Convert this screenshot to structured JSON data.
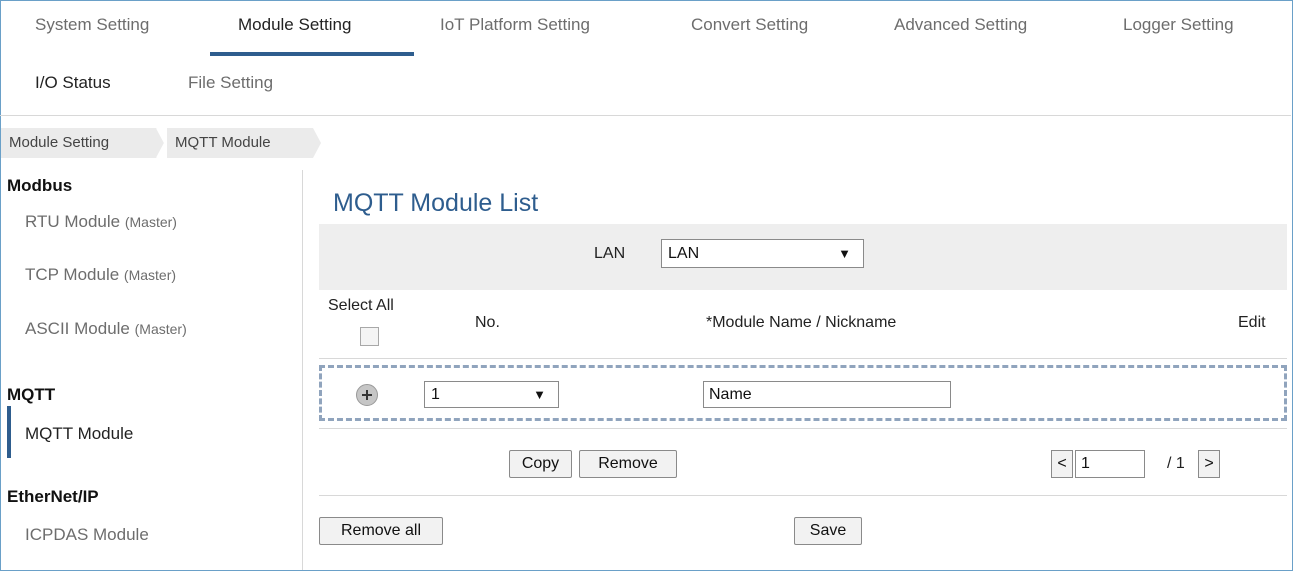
{
  "nav": {
    "tabs": [
      {
        "label": "System Setting"
      },
      {
        "label": "Module Setting"
      },
      {
        "label": "IoT Platform Setting"
      },
      {
        "label": "Convert Setting"
      },
      {
        "label": "Advanced Setting"
      },
      {
        "label": "Logger Setting"
      },
      {
        "label": "I/O Status"
      },
      {
        "label": "File Setting"
      }
    ],
    "active": "Module Setting"
  },
  "breadcrumb": [
    "Module Setting",
    "MQTT Module"
  ],
  "sidebar": {
    "groups": [
      {
        "title": "Modbus",
        "items": [
          {
            "label": "RTU Module",
            "suffix": "(Master)"
          },
          {
            "label": "TCP Module",
            "suffix": "(Master)"
          },
          {
            "label": "ASCII Module",
            "suffix": "(Master)"
          }
        ]
      },
      {
        "title": "MQTT",
        "items": [
          {
            "label": "MQTT Module",
            "suffix": ""
          }
        ]
      },
      {
        "title": "EtherNet/IP",
        "items": [
          {
            "label": "ICPDAS Module",
            "suffix": ""
          }
        ]
      }
    ]
  },
  "main": {
    "title": "MQTT Module List",
    "lan_label": "LAN",
    "lan_select": "LAN",
    "table": {
      "headers": {
        "select_all": "Select All",
        "no": "No.",
        "name": "*Module Name / Nickname",
        "edit": "Edit"
      },
      "new_row": {
        "no": "1",
        "name": "Name"
      }
    },
    "buttons": {
      "copy": "Copy",
      "remove": "Remove",
      "remove_all": "Remove all",
      "save": "Save"
    },
    "pagination": {
      "prev": "<",
      "page": "1",
      "total": "/ 1",
      "next": ">"
    }
  },
  "colors": {
    "accent": "#2e5d8e",
    "band": "#eeeeee",
    "dash": "#90a4bd"
  }
}
